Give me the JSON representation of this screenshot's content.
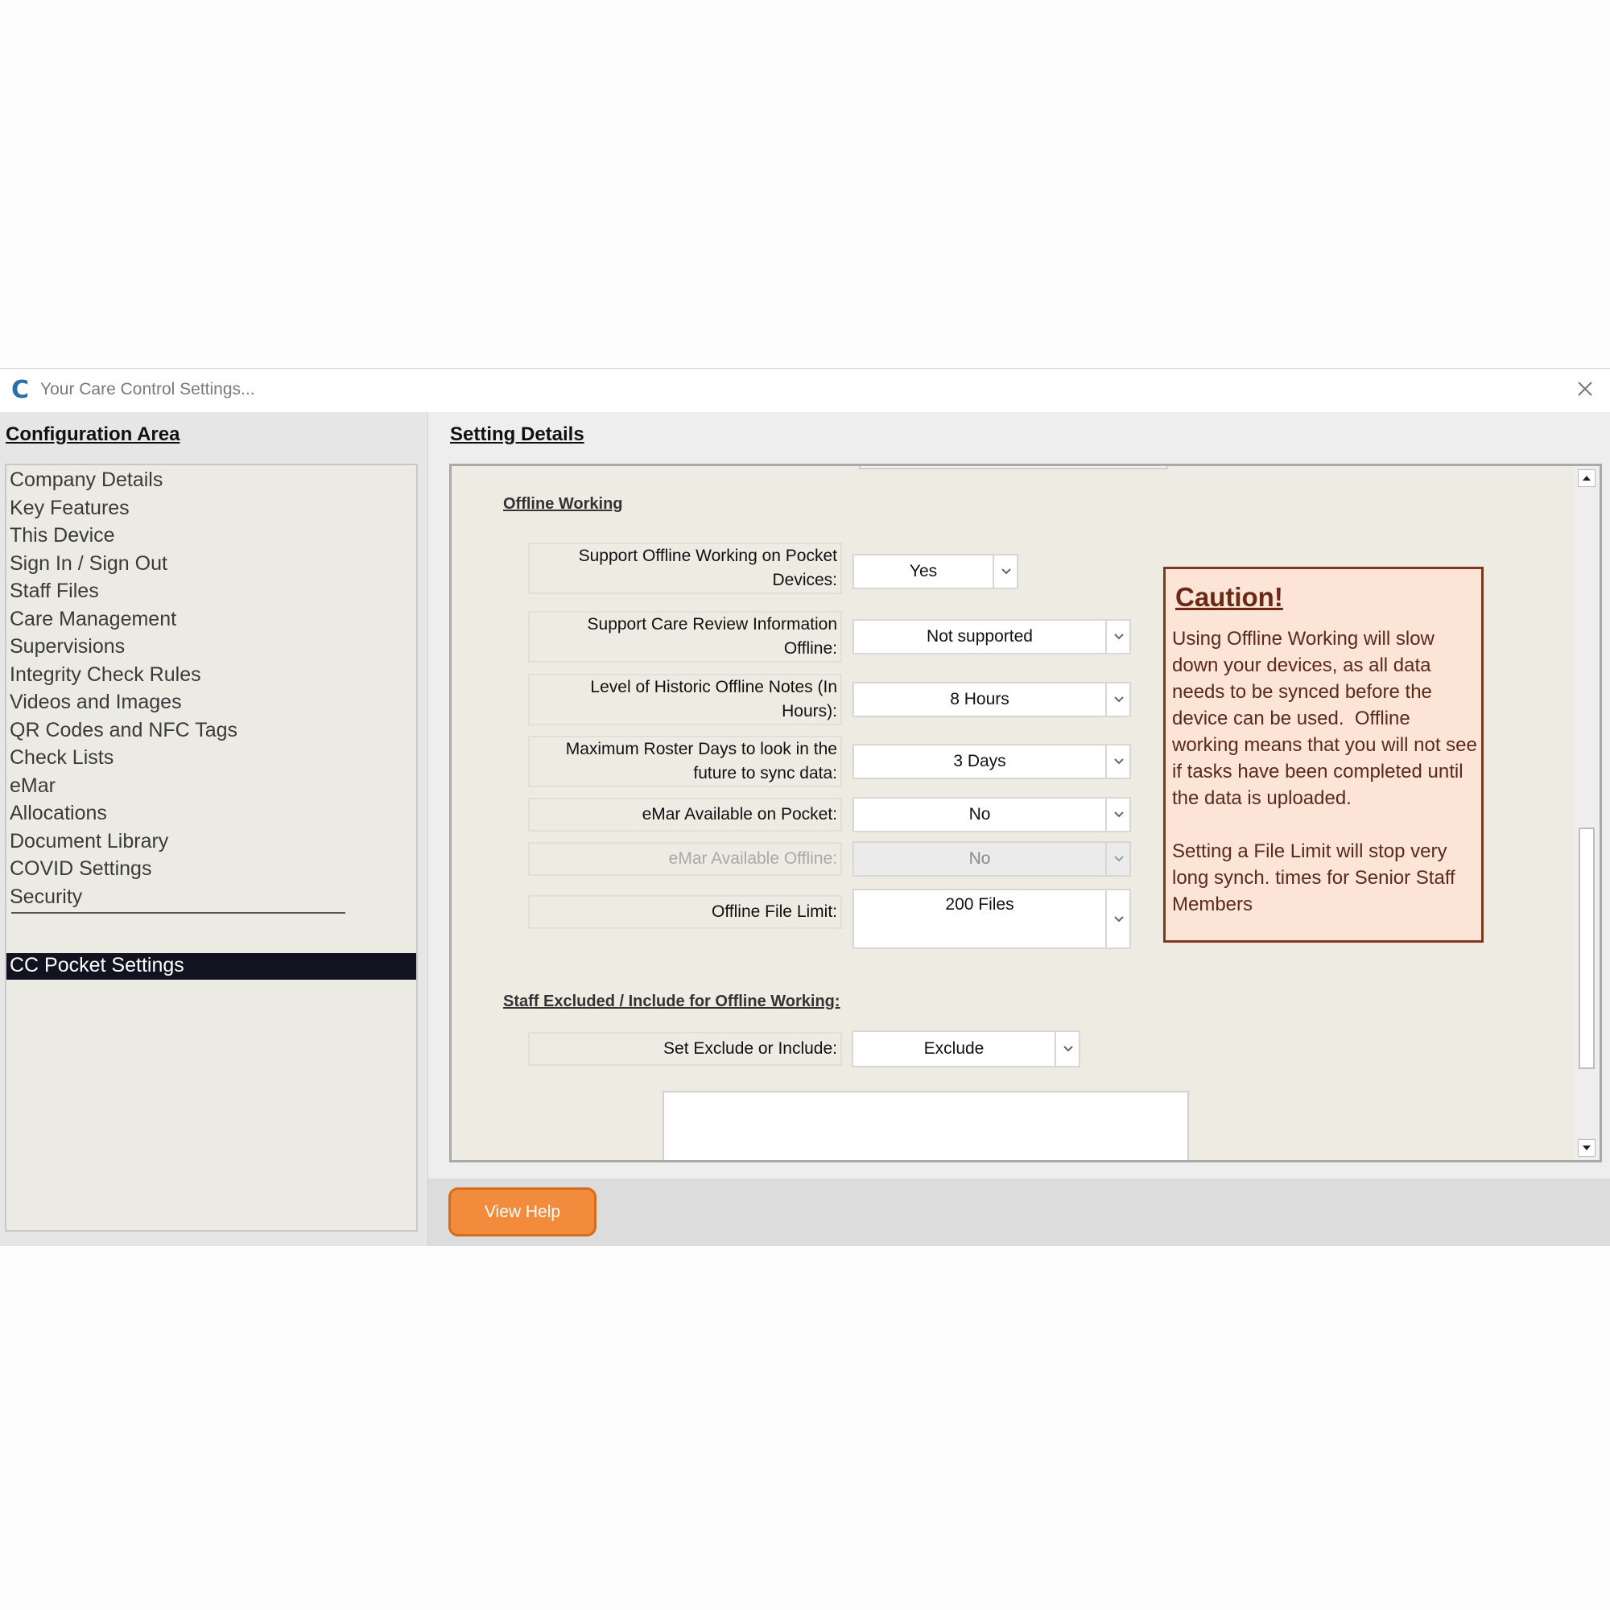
{
  "window": {
    "title": "Your Care Control Settings...",
    "logo_icon": "care-control-c-logo",
    "close_icon": "close-icon"
  },
  "left": {
    "heading": "Configuration Area",
    "items": [
      {
        "label": "Company Details"
      },
      {
        "label": "Key Features"
      },
      {
        "label": "This Device"
      },
      {
        "label": "Sign In / Sign Out"
      },
      {
        "label": "Staff Files"
      },
      {
        "label": "Care Management"
      },
      {
        "label": "Supervisions"
      },
      {
        "label": "Integrity Check Rules"
      },
      {
        "label": "Videos and Images"
      },
      {
        "label": "QR Codes and NFC Tags"
      },
      {
        "label": "Check Lists"
      },
      {
        "label": "eMar"
      },
      {
        "label": "Allocations"
      },
      {
        "label": "Document Library"
      },
      {
        "label": "COVID Settings"
      },
      {
        "label": "Security"
      }
    ],
    "selected_item": "CC Pocket Settings",
    "selected_color": "#121221"
  },
  "details": {
    "heading": "Setting Details",
    "offline_heading": "Offline Working",
    "fields": [
      {
        "label": "Support Offline Working on Pocket Devices:",
        "value": "Yes",
        "enabled": true
      },
      {
        "label": "Support Care Review Information Offline:",
        "value": "Not supported",
        "enabled": true
      },
      {
        "label": "Level of Historic Offline Notes (In Hours):",
        "value": "8 Hours",
        "enabled": true
      },
      {
        "label": "Maximum Roster Days to look in the future to sync data:",
        "value": "3 Days",
        "enabled": true
      },
      {
        "label": "eMar Available on Pocket:",
        "value": "No",
        "enabled": true
      },
      {
        "label": "eMar Available Offline:",
        "value": "No",
        "enabled": false
      },
      {
        "label": "Offline File Limit:",
        "value": "200 Files",
        "enabled": true
      }
    ],
    "caution": {
      "title": "Caution!",
      "body": "Using Offline Working will slow down your devices, as all data needs to be synced before the device can be used.  Offline working means that you will not see if tasks have been completed until the data is uploaded.\n\nSetting a File Limit will stop very long synch. times for Senior Staff Members",
      "background": "#fce4d6",
      "border_color": "#7b3a1f"
    },
    "staff_heading": "Staff Excluded / Include for Offline Working:",
    "exclude_include": {
      "label": "Set Exclude or Include:",
      "value": "Exclude"
    }
  },
  "footer": {
    "help_button": "View Help",
    "help_color": "#f28c3c"
  }
}
